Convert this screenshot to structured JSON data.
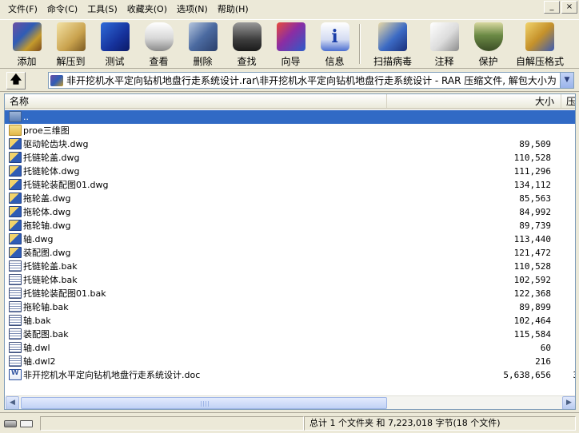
{
  "menu": {
    "items": [
      "文件(F)",
      "命令(C)",
      "工具(S)",
      "收藏夹(O)",
      "选项(N)",
      "帮助(H)"
    ]
  },
  "window_buttons": {
    "minimize": "_",
    "close": "×"
  },
  "toolbar": {
    "buttons": [
      {
        "label": "添加",
        "icon": "add-archive-icon"
      },
      {
        "label": "解压到",
        "icon": "extract-to-icon"
      },
      {
        "label": "测试",
        "icon": "test-icon"
      },
      {
        "label": "查看",
        "icon": "view-icon"
      },
      {
        "label": "删除",
        "icon": "delete-icon"
      },
      {
        "label": "查找",
        "icon": "find-binoculars-icon"
      },
      {
        "label": "向导",
        "icon": "wizard-icon"
      },
      {
        "label": "信息",
        "icon": "info-icon"
      },
      {
        "label": "扫描病毒",
        "icon": "scan-virus-icon"
      },
      {
        "label": "注释",
        "icon": "comment-icon"
      },
      {
        "label": "保护",
        "icon": "protect-shield-icon"
      },
      {
        "label": "自解压格式",
        "icon": "sfx-icon"
      }
    ]
  },
  "address": {
    "up_icon": "up-folder-icon",
    "path": "非开挖机水平定向钻机地盘行走系统设计.rar\\非开挖机水平定向钻机地盘行走系统设计 - RAR 压缩文件, 解包大小为"
  },
  "list": {
    "columns": {
      "name": "名称",
      "size": "大小",
      "packed": "压"
    },
    "rows": [
      {
        "name": "..",
        "size": "",
        "packed": "",
        "type": "up",
        "selected": true
      },
      {
        "name": "proe三维图",
        "size": "",
        "packed": "",
        "type": "folder"
      },
      {
        "name": "驱动轮齿块.dwg",
        "size": "89,509",
        "packed": "",
        "type": "dwg"
      },
      {
        "name": "托链轮盖.dwg",
        "size": "110,528",
        "packed": "",
        "type": "dwg"
      },
      {
        "name": "托链轮体.dwg",
        "size": "111,296",
        "packed": "",
        "type": "dwg"
      },
      {
        "name": "托链轮装配图01.dwg",
        "size": "134,112",
        "packed": "",
        "type": "dwg"
      },
      {
        "name": "拖轮盖.dwg",
        "size": "85,563",
        "packed": "",
        "type": "dwg"
      },
      {
        "name": "拖轮体.dwg",
        "size": "84,992",
        "packed": "",
        "type": "dwg"
      },
      {
        "name": "拖轮轴.dwg",
        "size": "89,739",
        "packed": "",
        "type": "dwg"
      },
      {
        "name": "轴.dwg",
        "size": "113,440",
        "packed": "",
        "type": "dwg"
      },
      {
        "name": "装配图.dwg",
        "size": "121,472",
        "packed": "",
        "type": "dwg"
      },
      {
        "name": "托链轮盖.bak",
        "size": "110,528",
        "packed": "",
        "type": "bak"
      },
      {
        "name": "托链轮体.bak",
        "size": "102,592",
        "packed": "",
        "type": "bak"
      },
      {
        "name": "托链轮装配图01.bak",
        "size": "122,368",
        "packed": "",
        "type": "bak"
      },
      {
        "name": "拖轮轴.bak",
        "size": "89,899",
        "packed": "",
        "type": "bak"
      },
      {
        "name": "轴.bak",
        "size": "102,464",
        "packed": "",
        "type": "bak"
      },
      {
        "name": "装配图.bak",
        "size": "115,584",
        "packed": "",
        "type": "bak"
      },
      {
        "name": "轴.dwl",
        "size": "60",
        "packed": "",
        "type": "bak"
      },
      {
        "name": "轴.dwl2",
        "size": "216",
        "packed": "",
        "type": "bak"
      },
      {
        "name": "非开挖机水平定向钻机地盘行走系统设计.doc",
        "size": "5,638,656",
        "packed": "3",
        "type": "doc"
      }
    ]
  },
  "scrollbar": {
    "left_arrow": "◀",
    "right_arrow": "▶"
  },
  "status": {
    "summary": "总计 1 个文件夹 和 7,223,018 字节(18 个文件)"
  }
}
